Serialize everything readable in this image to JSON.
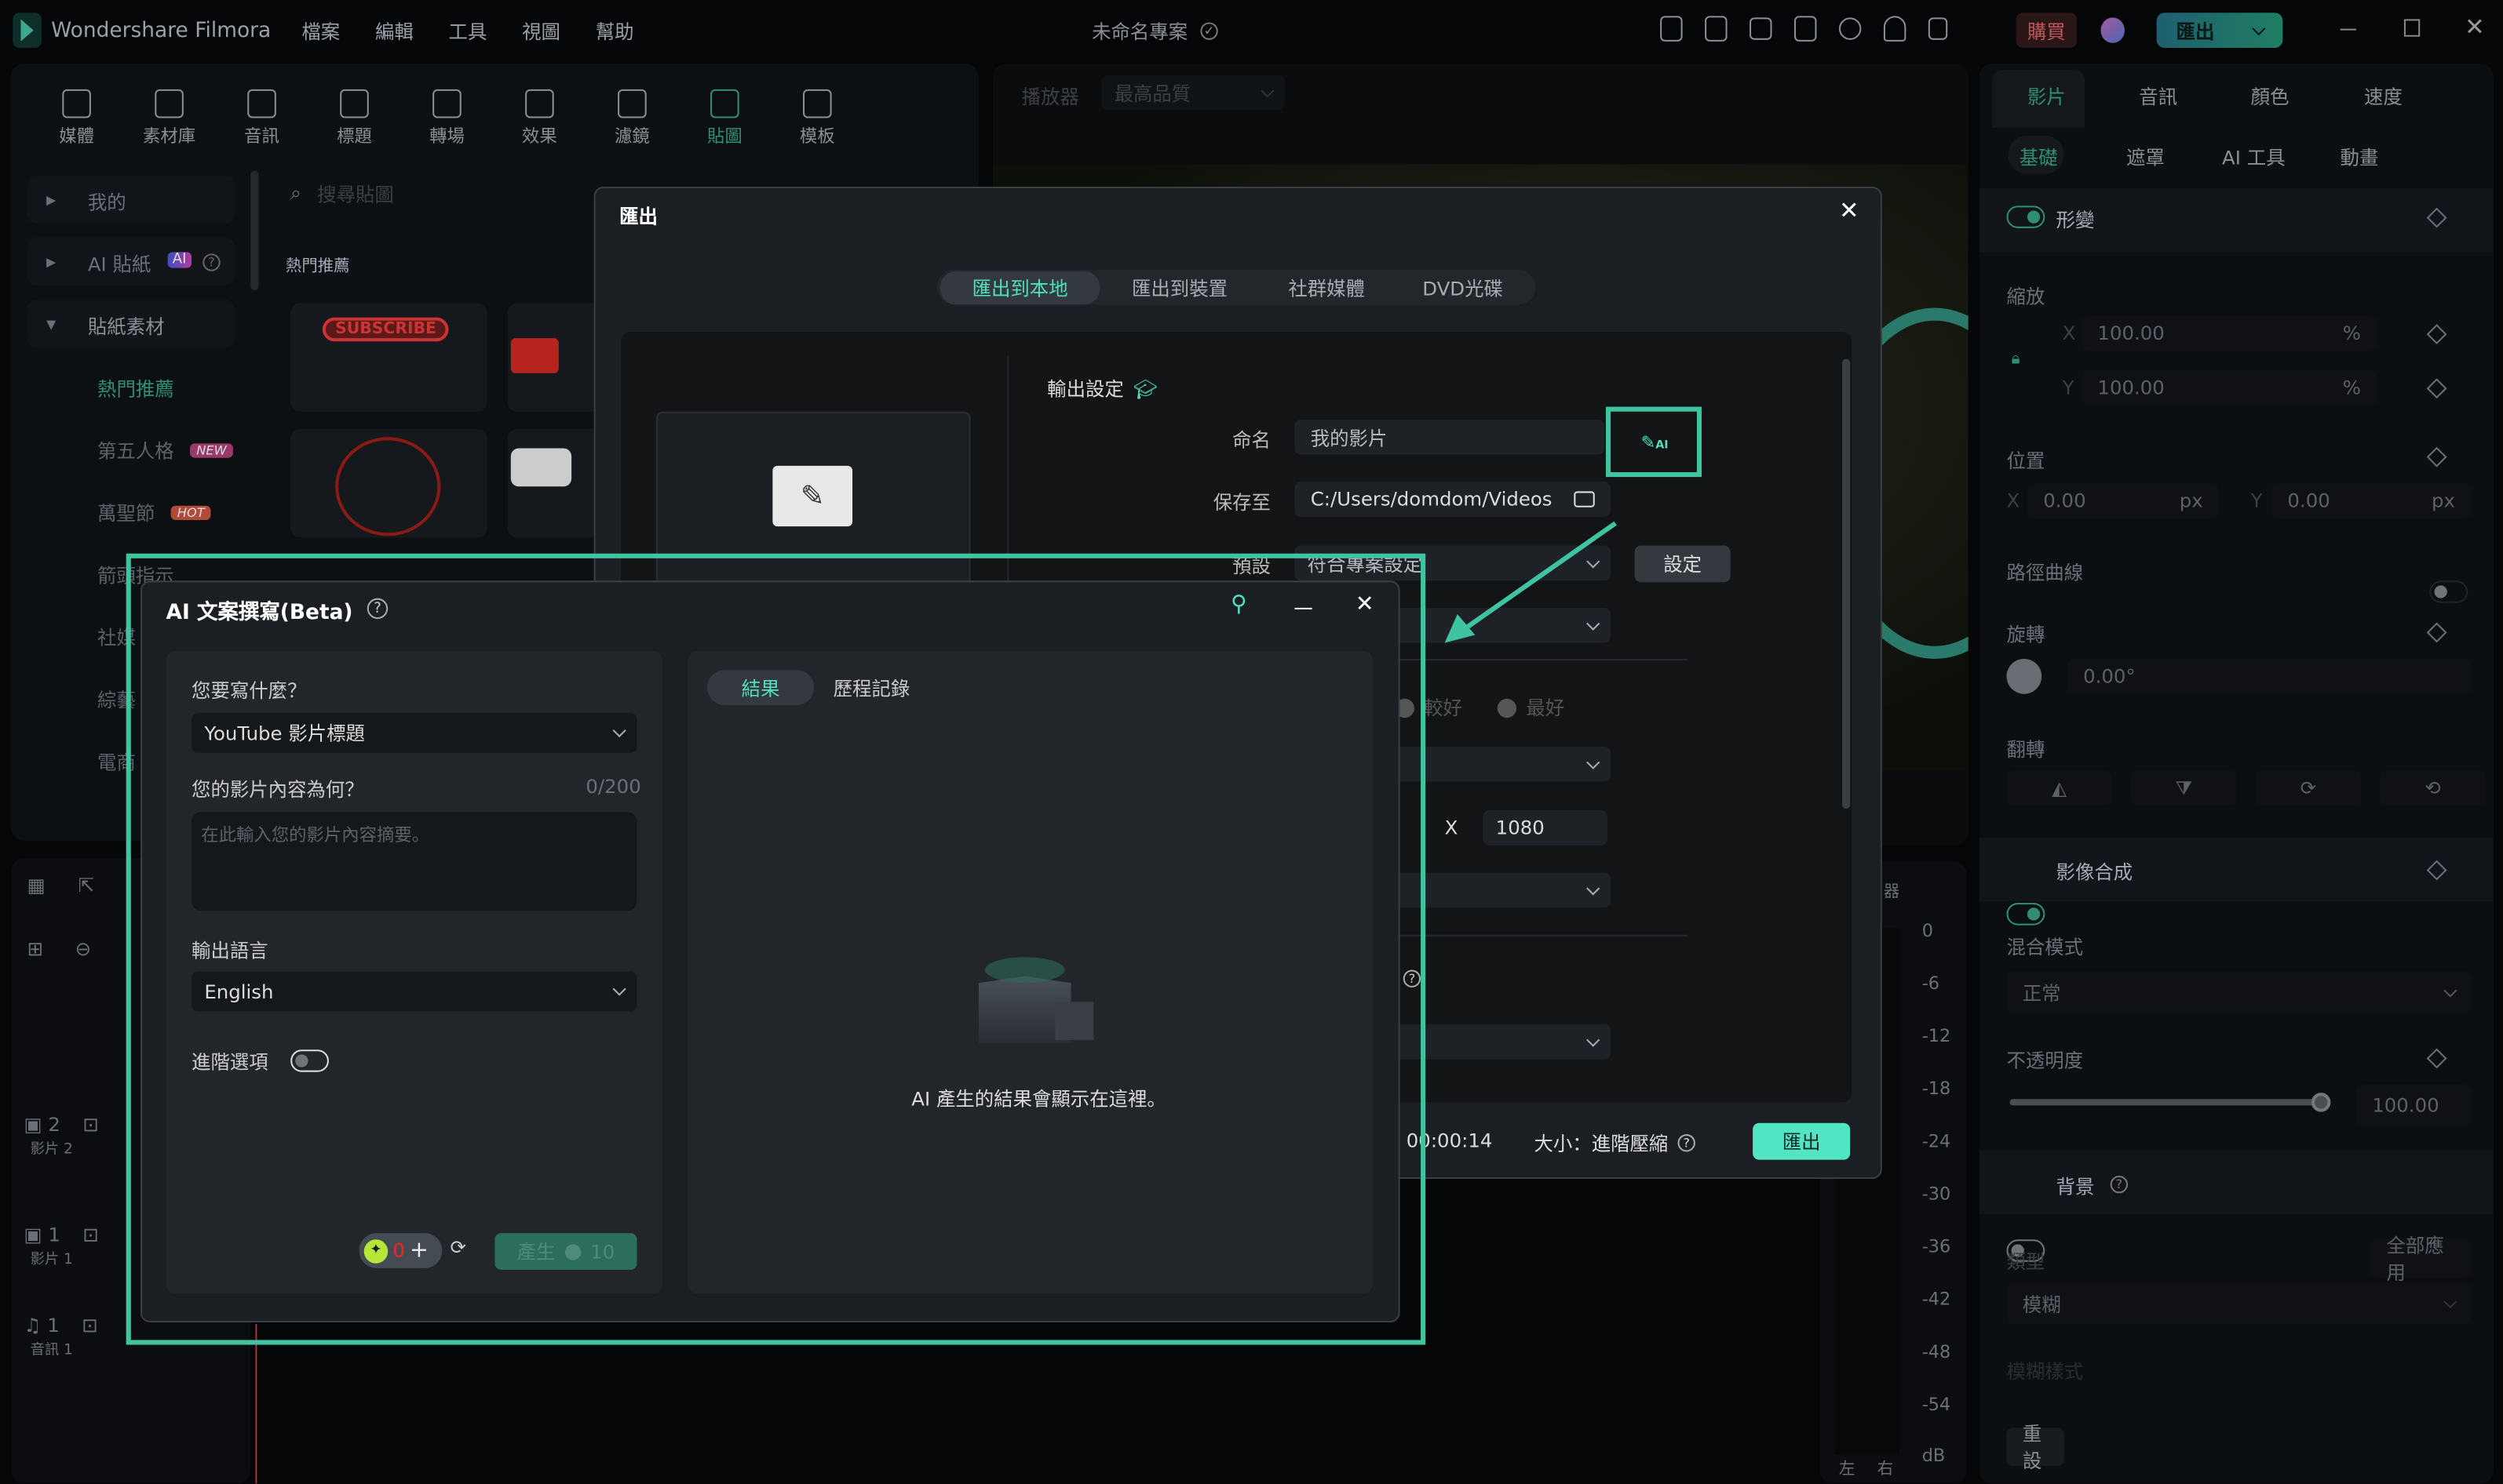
{
  "app": {
    "title": "Wondershare Filmora",
    "menu": [
      "檔案",
      "編輯",
      "工具",
      "視圖",
      "幫助"
    ],
    "project": "未命名專案",
    "buy": "購買",
    "export": "匯出",
    "top_icons": [
      "send-icon",
      "cloud-render-icon",
      "layout-icon",
      "save-icon",
      "cloud-upload-icon",
      "headset-icon",
      "apps-icon"
    ]
  },
  "colors": {
    "accent": "#4fe0bf",
    "highlight": "#3fc3a0",
    "background": "#0a0c0e",
    "dialog": "#1b1e22"
  },
  "toolbar": [
    {
      "label": "媒體",
      "icon": "media-icon"
    },
    {
      "label": "素材庫",
      "icon": "library-icon"
    },
    {
      "label": "音訊",
      "icon": "music-icon"
    },
    {
      "label": "標題",
      "icon": "title-icon"
    },
    {
      "label": "轉場",
      "icon": "transition-icon"
    },
    {
      "label": "效果",
      "icon": "effects-icon"
    },
    {
      "label": "濾鏡",
      "icon": "filter-icon"
    },
    {
      "label": "貼圖",
      "icon": "sticker-icon",
      "active": true
    },
    {
      "label": "模板",
      "icon": "template-icon"
    }
  ],
  "sidebar": {
    "items": [
      {
        "label": "我的"
      },
      {
        "label": "AI 貼紙",
        "badge": "AI"
      },
      {
        "label": "貼紙素材"
      }
    ],
    "sub": [
      {
        "label": "熱門推薦",
        "active": true
      },
      {
        "label": "第五人格",
        "badge": "NEW"
      },
      {
        "label": "萬聖節",
        "badge": "HOT"
      },
      {
        "label": "箭頭指示"
      },
      {
        "label": "社媒"
      },
      {
        "label": "綜藝"
      },
      {
        "label": "電商"
      }
    ]
  },
  "stickers": {
    "search_placeholder": "搜尋貼圖",
    "heading": "熱門推薦",
    "subscribe": "SUBSCRIBE"
  },
  "player": {
    "label": "播放器",
    "quality": "最高品質"
  },
  "meter": {
    "label": "器",
    "ticks": [
      "0",
      "-6",
      "-12",
      "-18",
      "-24",
      "-30",
      "-36",
      "-42",
      "-48",
      "-54"
    ],
    "unit": "dB",
    "left": "左",
    "right": "右"
  },
  "timeline": {
    "tracks": [
      {
        "num": "2",
        "name": "影片 2"
      },
      {
        "num": "1",
        "name": "影片 1"
      },
      {
        "num": "1",
        "name": "音訊 1"
      }
    ]
  },
  "inspector": {
    "tabs": [
      "影片",
      "音訊",
      "顏色",
      "速度"
    ],
    "subtabs": [
      "基礎",
      "遮罩",
      "AI 工具",
      "動畫"
    ],
    "transform": "形變",
    "scale": "縮放",
    "scale_x": "100.00",
    "scale_y": "100.00",
    "pct": "%",
    "x": "X",
    "y": "Y",
    "position": "位置",
    "pos_x": "0.00",
    "pos_y": "0.00",
    "px": "px",
    "path_curve": "路徑曲線",
    "rotate": "旋轉",
    "rotate_val": "0.00°",
    "flip": "翻轉",
    "compositing": "影像合成",
    "blend_mode": "混合模式",
    "blend_val": "正常",
    "opacity": "不透明度",
    "opacity_val": "100.00",
    "opacity_level": 100,
    "background": "背景",
    "type": "類型",
    "apply_all": "全部應用",
    "blur_val": "模糊",
    "blur_style": "模糊樣式",
    "reset": "重設"
  },
  "export_dialog": {
    "title": "匯出",
    "tabs": [
      "匯出到本地",
      "匯出到裝置",
      "社群媒體",
      "DVD光碟"
    ],
    "output_settings": "輸出設定",
    "name_label": "命名",
    "name_value": "我的影片",
    "save_label": "保存至",
    "save_value": "C:/Users/domdom/Videos",
    "preset_label": "預設",
    "preset_value": "符合專案設定",
    "settings_btn": "設定",
    "quality_better": "較好",
    "quality_best": "最好",
    "res_x": "X",
    "res_h": "1080",
    "duration": "00:00:14",
    "size": "大小：進階壓縮",
    "export_btn": "匯出"
  },
  "ai_dialog": {
    "title": "AI 文案撰寫(Beta)",
    "q1": "您要寫什麼？",
    "q1_value": "YouTube 影片標題",
    "q2": "您的影片內容為何？",
    "counter": "0/200",
    "q2_placeholder": "在此輸入您的影片內容摘要。",
    "lang_label": "輸出語言",
    "lang_value": "English",
    "advanced": "進階選項",
    "credits": "0",
    "generate": "產生",
    "cost": "10",
    "tab_result": "結果",
    "tab_history": "歷程記錄",
    "empty": "AI 產生的結果會顯示在這裡。"
  }
}
